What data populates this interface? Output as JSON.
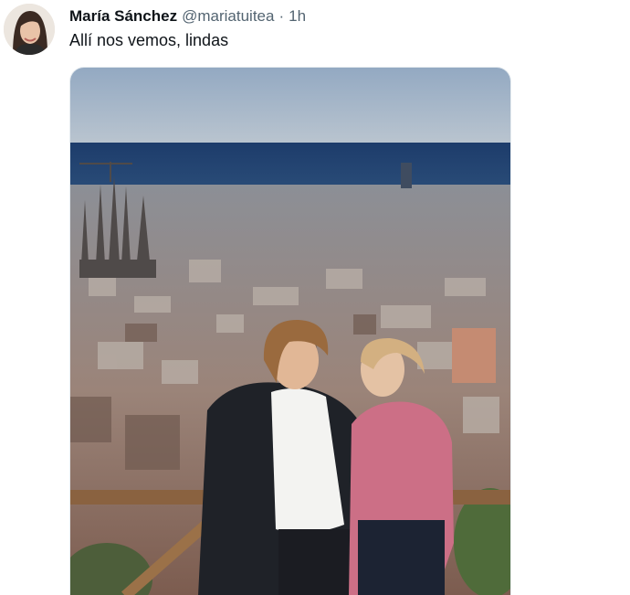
{
  "tweet": {
    "author_name": "María Sánchez",
    "handle": "@mariatuitea",
    "separator": "·",
    "timestamp": "1h",
    "text": "Allí nos vemos, lindas"
  },
  "icons": {
    "avatar": "user-avatar-photo"
  }
}
